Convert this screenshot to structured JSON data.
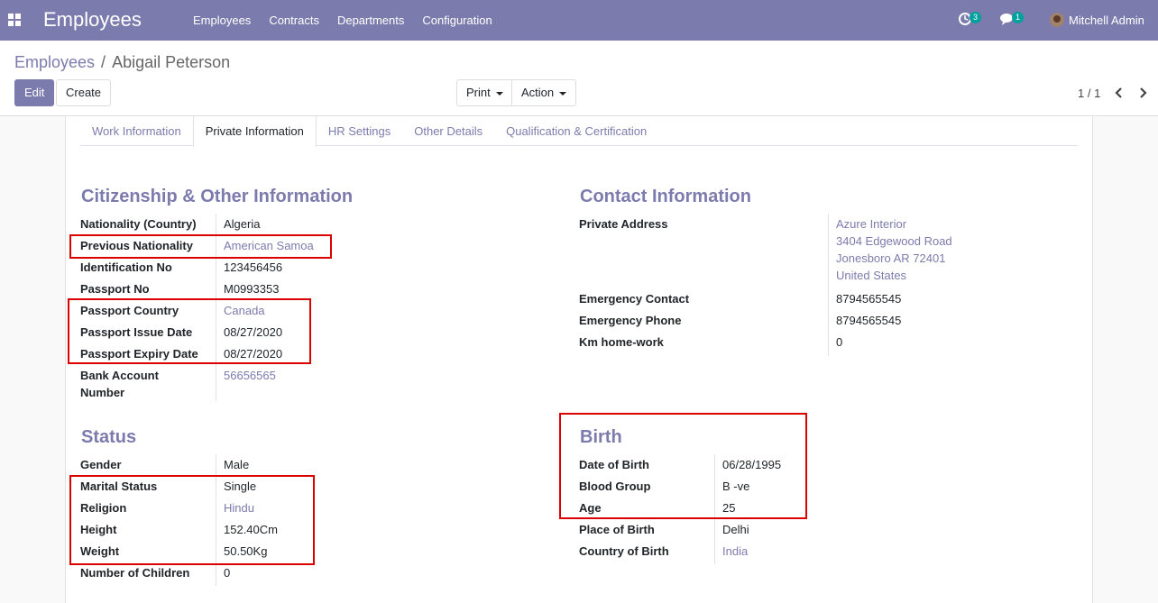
{
  "navbar": {
    "brand": "Employees",
    "menu": [
      "Employees",
      "Contracts",
      "Departments",
      "Configuration"
    ],
    "activity_count": "3",
    "message_count": "1",
    "user_name": "Mitchell Admin"
  },
  "breadcrumb": {
    "parent": "Employees",
    "separator": "/",
    "current": "Abigail Peterson"
  },
  "buttons": {
    "edit": "Edit",
    "create": "Create",
    "print": "Print",
    "action": "Action"
  },
  "pager": {
    "text": "1 / 1"
  },
  "tabs": [
    "Work Information",
    "Private Information",
    "HR Settings",
    "Other Details",
    "Qualification & Certification"
  ],
  "citizenship": {
    "title": "Citizenship & Other Information",
    "fields": [
      {
        "label": "Nationality (Country)",
        "value": "Algeria"
      },
      {
        "label": "Previous Nationality",
        "value": "American Samoa"
      },
      {
        "label": "Identification No",
        "value": "123456456"
      },
      {
        "label": "Passport No",
        "value": "M0993353"
      },
      {
        "label": "Passport Country",
        "value": "Canada"
      },
      {
        "label": "Passport Issue Date",
        "value": "08/27/2020"
      },
      {
        "label": "Passport Expiry Date",
        "value": "08/27/2020"
      },
      {
        "label": "Bank Account",
        "label2": "Number",
        "value": "56656565"
      }
    ]
  },
  "contact": {
    "title": "Contact Information",
    "private_address_label": "Private Address",
    "address_lines": [
      "Azure Interior",
      "3404 Edgewood Road",
      "Jonesboro AR 72401",
      "United States"
    ],
    "fields": [
      {
        "label": "Emergency Contact",
        "value": "8794565545"
      },
      {
        "label": "Emergency Phone",
        "value": "8794565545"
      },
      {
        "label": "Km home-work",
        "value": "0"
      }
    ]
  },
  "status": {
    "title": "Status",
    "fields": [
      {
        "label": "Gender",
        "value": "Male"
      },
      {
        "label": "Marital Status",
        "value": "Single"
      },
      {
        "label": "Religion",
        "value": "Hindu"
      },
      {
        "label": "Height",
        "value": "152.40Cm"
      },
      {
        "label": "Weight",
        "value": "50.50Kg"
      },
      {
        "label": "Number of Children",
        "value": "0"
      }
    ]
  },
  "birth": {
    "title": "Birth",
    "fields": [
      {
        "label": "Date of Birth",
        "value": "06/28/1995"
      },
      {
        "label": "Blood Group",
        "value": "B -ve"
      },
      {
        "label": "Age",
        "value": "25"
      },
      {
        "label": "Place of Birth",
        "value": "Delhi"
      },
      {
        "label": "Country of Birth",
        "value": "India"
      }
    ]
  },
  "colors": {
    "brand": "#7c7bad",
    "highlight": "#dd0000",
    "badge": "#00a09d"
  }
}
